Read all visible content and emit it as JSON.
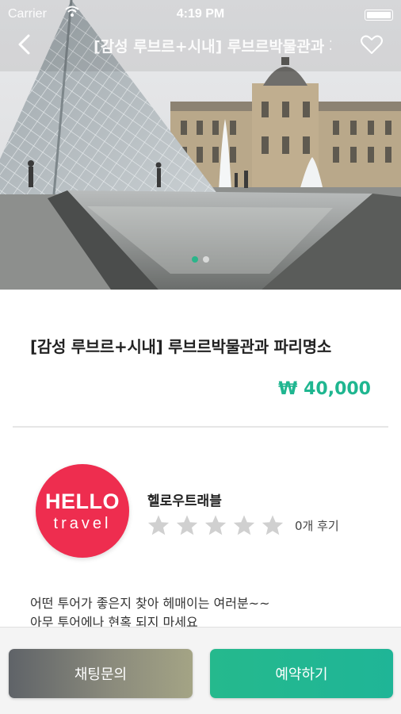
{
  "status_bar": {
    "carrier": "Carrier",
    "time": "4:19 PM"
  },
  "nav": {
    "title": "[감성 루브르+시내] 루브르박물관과 파리명소",
    "back_icon": "chevron-left-icon",
    "favorite_icon": "heart-outline-icon"
  },
  "gallery": {
    "slide_count": 2,
    "active_index": 0
  },
  "tour": {
    "title": "[감성 루브르+시내] 루브르박물관과 파리명소",
    "price": "₩ 40,000"
  },
  "host": {
    "logo_line1": "HELLO",
    "logo_line2": "travel",
    "name": "헬로우트래블",
    "rating": 0,
    "rating_max": 5,
    "review_count": "0개 후기"
  },
  "description": "어떤 투어가 좋은지 찾아 헤매이는 여러분~~\n아무 투어에나 현혹 되지 마세요",
  "actions": {
    "chat_label": "채팅문의",
    "book_label": "예약하기"
  },
  "colors": {
    "accent": "#1fb690",
    "logo_bg": "#ee2d4f",
    "star_empty": "#d0d0d0"
  }
}
